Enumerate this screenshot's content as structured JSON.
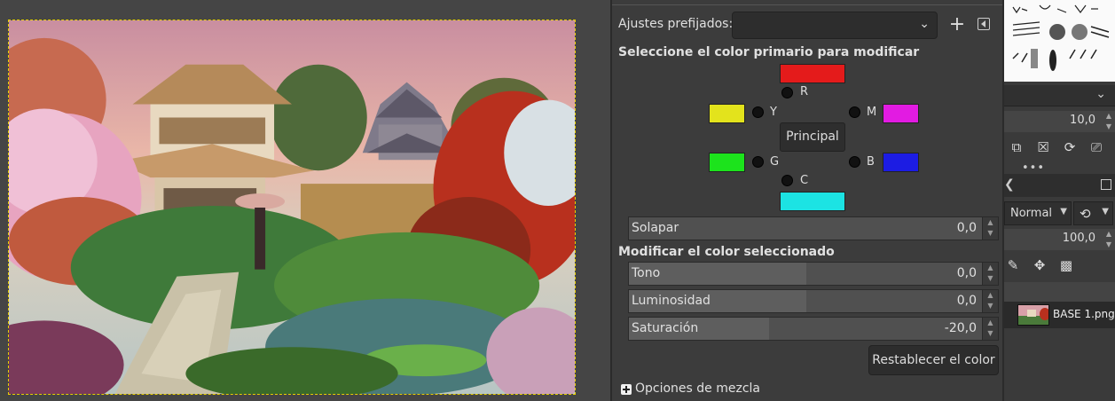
{
  "dialog": {
    "presets_label": "Ajustes prefijados:",
    "presets_value": "",
    "select_primary_heading": "Seleccione el color primario para modificar",
    "primaries": {
      "r": {
        "label": "R",
        "color": "#e41b1b"
      },
      "y": {
        "label": "Y",
        "color": "#e3e31c"
      },
      "m": {
        "label": "M",
        "color": "#e21be2"
      },
      "g": {
        "label": "G",
        "color": "#1ce31c"
      },
      "b": {
        "label": "B",
        "color": "#1c1ce3"
      },
      "c": {
        "label": "C",
        "color": "#1ce3e3"
      }
    },
    "principal_label": "Principal",
    "overlap": {
      "label": "Solapar",
      "value": "0,0"
    },
    "modify_heading": "Modificar el color seleccionado",
    "hue": {
      "label": "Tono",
      "value": "0,0",
      "fill_fraction": 0.48
    },
    "lightness": {
      "label": "Luminosidad",
      "value": "0,0",
      "fill_fraction": 0.48
    },
    "saturation": {
      "label": "Saturación",
      "value": "-20,0",
      "fill_fraction": 0.38
    },
    "reset_label": "Restablecer el color",
    "blend_options_label": "Opciones de mezcla"
  },
  "dock": {
    "size_value": "10,0",
    "mode_value": "Normal",
    "opacity_value": "100,0",
    "layer_name": "BASE 1.png"
  },
  "icons": {
    "add": "plus-icon",
    "preset_menu": "menu-arrow-icon",
    "combo": "chevron-down-icon",
    "expander": "expander-plus-icon"
  }
}
